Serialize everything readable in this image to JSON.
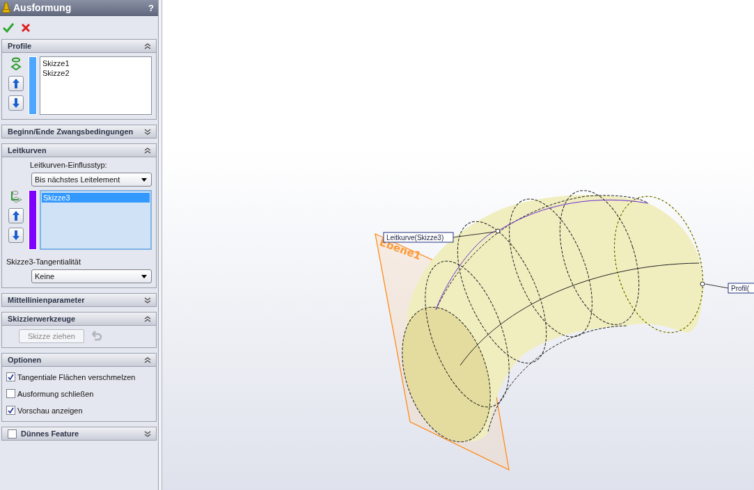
{
  "panel": {
    "title": "Ausformung",
    "help": "?"
  },
  "sections": [
    {
      "kind": "list",
      "title": "Profile",
      "expanded": true,
      "color": "#4da6ff",
      "items": [
        {
          "label": "Skizze1",
          "selected": false
        },
        {
          "label": "Skizze2",
          "selected": false
        }
      ]
    },
    {
      "kind": "header",
      "title": "Beginn/Ende Zwangsbedingungen",
      "expanded": false
    },
    {
      "kind": "guides",
      "title": "Leitkurven",
      "expanded": true,
      "influence_label": "Leitkurven-Einflusstyp:",
      "influence_value": "Bis nächstes Leitelement",
      "color": "#8000ff",
      "items": [
        {
          "label": "Skizze3",
          "selected": true
        }
      ],
      "tangency_label": "Skizze3-Tangentialität",
      "tangency_value": "Keine"
    },
    {
      "kind": "header",
      "title": "Mittellinienparameter",
      "expanded": false
    },
    {
      "kind": "tools",
      "title": "Skizzierwerkzeuge",
      "expanded": true,
      "button": "Skizze ziehen",
      "disabled": true
    },
    {
      "kind": "options",
      "title": "Optionen",
      "expanded": true,
      "checkboxes": [
        {
          "label": "Tangentiale Flächen verschmelzen",
          "checked": true
        },
        {
          "label": "Ausformung schließen",
          "checked": false
        },
        {
          "label": "Vorschau anzeigen",
          "checked": true
        }
      ]
    },
    {
      "kind": "checkheader",
      "title": "Dünnes Feature",
      "expanded": false,
      "checked": false
    }
  ],
  "viewport": {
    "plane_label": "Ebene1",
    "callouts": [
      {
        "text": "Leitkurve(Skizze3)"
      },
      {
        "text": "Profil("
      }
    ]
  }
}
